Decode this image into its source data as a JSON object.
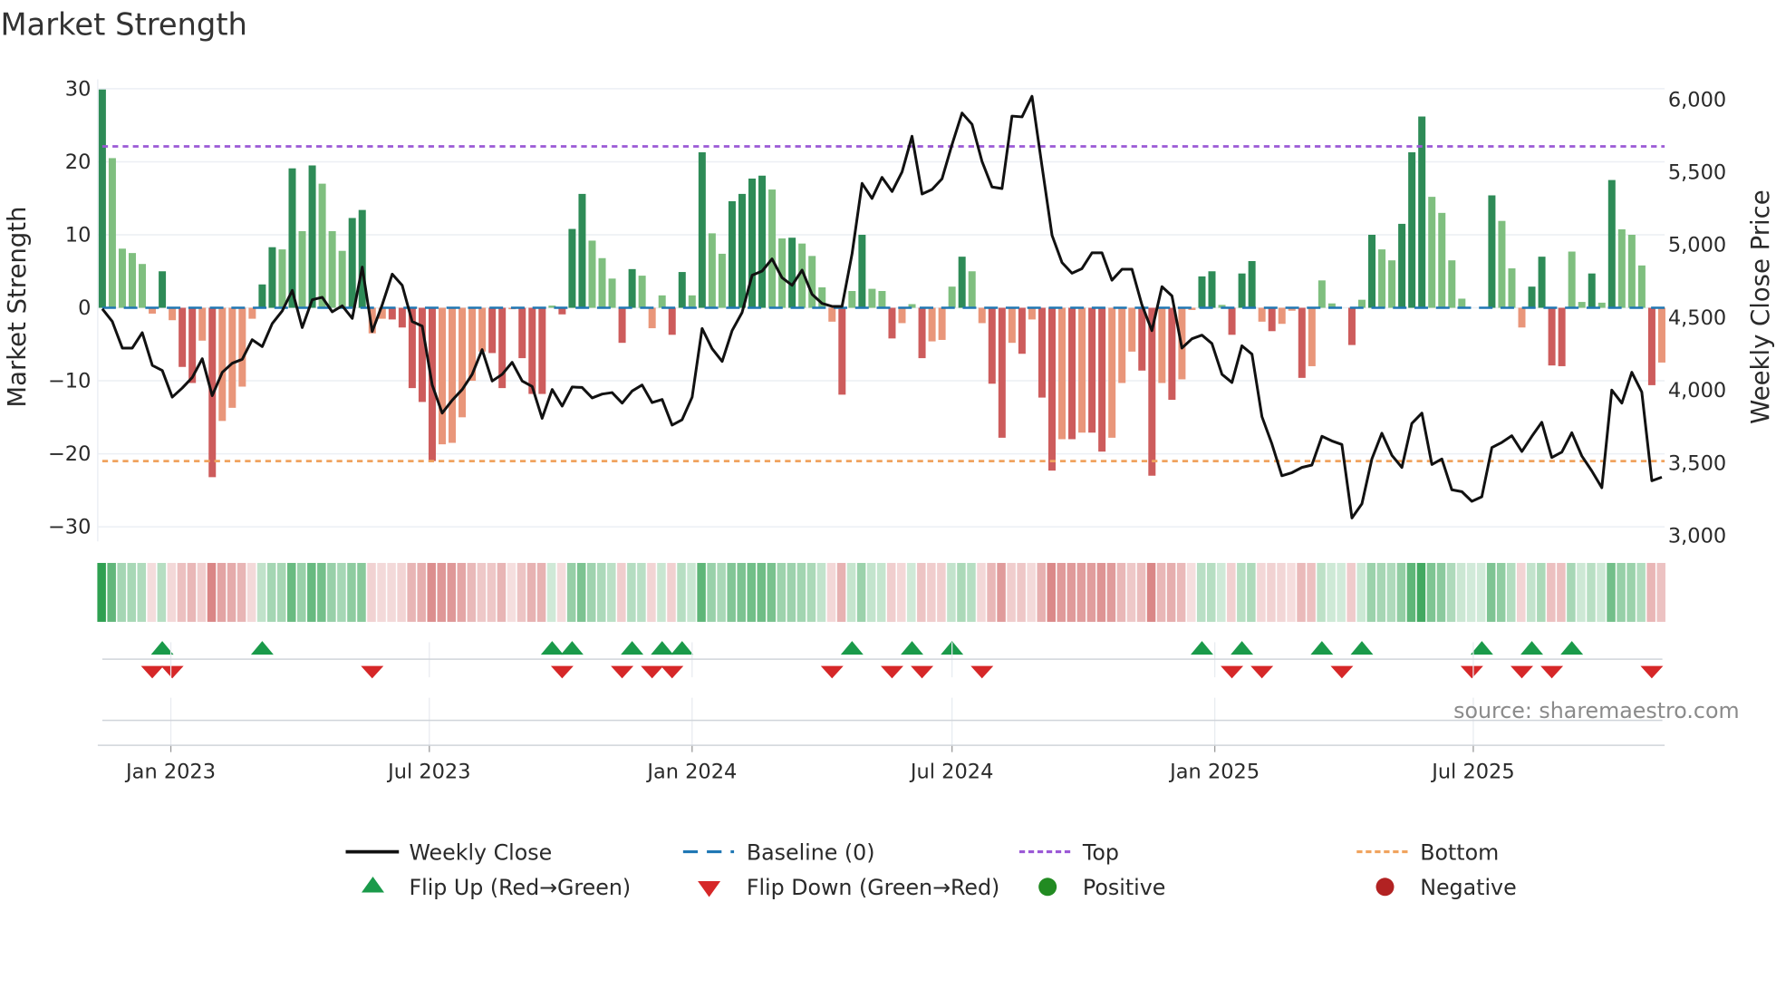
{
  "chart_data": {
    "type": "bar",
    "title": "Market Strength",
    "ylabel": "Market Strength",
    "y2label": "Weekly Close Price",
    "ylim": [
      -32,
      31.3
    ],
    "y2lim": [
      2953,
      6132
    ],
    "yticks": [
      30,
      20,
      10,
      0,
      -10,
      -20,
      -30
    ],
    "ytick_labels": [
      "30",
      "20",
      "10",
      "0",
      "−10",
      "−20",
      "−30"
    ],
    "y2ticks": [
      6000,
      5500,
      5000,
      4500,
      4000,
      3500,
      3000
    ],
    "y2tick_labels": [
      "6,000",
      "5,500",
      "5,000",
      "4,500",
      "4,000",
      "3,500",
      "3,000"
    ],
    "x_start": "2022-11-14",
    "x_step_days": 7,
    "xticks": [
      "2023-01-01",
      "2023-07-01",
      "2024-01-01",
      "2024-07-01",
      "2025-01-01",
      "2025-07-01"
    ],
    "xtick_labels": [
      "Jan 2023",
      "Jul 2023",
      "Jan 2024",
      "Jul 2024",
      "Jan 2025",
      "Jul 2025"
    ],
    "top": 22.1,
    "bottom": -21.0,
    "baseline": 0,
    "strength": [
      29.9,
      20.5,
      8.1,
      7.5,
      6,
      -0.8,
      5,
      -1.7,
      -8.1,
      -10.3,
      -4.5,
      -23.2,
      -15.5,
      -13.7,
      -10.8,
      -1.5,
      3.2,
      8.3,
      8,
      19.1,
      10.5,
      19.5,
      17,
      10.5,
      7.8,
      12.3,
      13.4,
      -3.5,
      -1.5,
      -1.6,
      -2.7,
      -11,
      -12.9,
      -21,
      -18.7,
      -18.5,
      -15,
      -10,
      -6,
      -6.2,
      -11,
      -0.2,
      -6.9,
      -11.8,
      -11.8,
      0.3,
      -0.9,
      10.8,
      15.6,
      9.2,
      6.8,
      4,
      -4.8,
      5.3,
      4.4,
      -2.8,
      1.7,
      -3.7,
      4.9,
      1.7,
      21.3,
      10.2,
      7.4,
      14.6,
      15.6,
      17.7,
      18.1,
      16.2,
      9.5,
      9.6,
      8.8,
      7.1,
      2.8,
      -1.9,
      -11.9,
      2.3,
      10,
      2.6,
      2.3,
      -4.2,
      -2.1,
      0.5,
      -6.9,
      -4.6,
      -4.4,
      2.9,
      7,
      5,
      -2.1,
      -10.4,
      -17.8,
      -4.8,
      -6.3,
      -1.6,
      -12.3,
      -22.3,
      -18,
      -18,
      -17.1,
      -17.1,
      -19.7,
      -17.8,
      -10.3,
      -6,
      -8.6,
      -23,
      -10.3,
      -12.6,
      -9.8,
      -0.3,
      4.3,
      5,
      0.4,
      -3.7,
      4.7,
      6.4,
      -1.9,
      -3.2,
      -2.2,
      -0.4,
      -9.6,
      -8,
      3.75,
      0.6,
      0,
      -5.1,
      1.1,
      10,
      8,
      6.5,
      11.5,
      21.3,
      26.2,
      15.2,
      13,
      6.5,
      1.25,
      0,
      0,
      15.4,
      11.9,
      5.4,
      -2.7,
      2.9,
      7,
      -7.9,
      -8,
      7.7,
      0.8,
      4.7,
      0.7,
      17.5,
      10.75,
      10,
      5.8,
      -10.6,
      -7.5
    ],
    "weekly_close": [
      4553,
      4466,
      4283,
      4283,
      4389,
      4164,
      4129,
      3946,
      4008,
      4081,
      4210,
      3956,
      4116,
      4179,
      4206,
      4341,
      4293,
      4451,
      4538,
      4680,
      4424,
      4615,
      4632,
      4532,
      4574,
      4487,
      4840,
      4397,
      4580,
      4792,
      4715,
      4466,
      4434,
      4029,
      3836,
      3925,
      3998,
      4102,
      4272,
      4056,
      4102,
      4185,
      4056,
      4019,
      3800,
      3998,
      3884,
      4015,
      4012,
      3940,
      3967,
      3977,
      3904,
      3988,
      4029,
      3908,
      3929,
      3753,
      3790,
      3946,
      4418,
      4279,
      4191,
      4403,
      4528,
      4784,
      4813,
      4896,
      4767,
      4715,
      4819,
      4653,
      4590,
      4570,
      4570,
      4934,
      5416,
      5312,
      5457,
      5360,
      5495,
      5740,
      5343,
      5374,
      5447,
      5682,
      5900,
      5823,
      5568,
      5391,
      5380,
      5879,
      5873,
      6015,
      5536,
      5058,
      4871,
      4798,
      4829,
      4938,
      4938,
      4750,
      4825,
      4825,
      4580,
      4403,
      4705,
      4642,
      4283,
      4347,
      4372,
      4314,
      4102,
      4046,
      4299,
      4241,
      3811,
      3624,
      3405,
      3426,
      3462,
      3478,
      3676,
      3644,
      3620,
      3114,
      3212,
      3520,
      3697,
      3545,
      3462,
      3765,
      3836,
      3482,
      3520,
      3308,
      3295,
      3229,
      3260,
      3599,
      3634,
      3680,
      3572,
      3676,
      3773,
      3530,
      3568,
      3701,
      3541,
      3437,
      3322,
      3994,
      3904,
      4116,
      3981,
      3370,
      3395
    ],
    "flip_up_index": [
      6,
      16,
      45,
      47,
      53,
      56,
      58,
      75,
      81,
      85,
      110,
      114,
      122,
      126,
      138,
      143,
      147
    ],
    "flip_down_index": [
      5,
      7,
      27,
      46,
      52,
      55,
      57,
      73,
      79,
      82,
      88,
      113,
      116,
      124,
      137,
      142,
      145,
      155
    ],
    "legend": {
      "placement": "bottom",
      "items": [
        {
          "label": "Weekly Close",
          "kind": "line"
        },
        {
          "label": "Baseline (0)",
          "kind": "dash"
        },
        {
          "label": "Top",
          "kind": "dot-top"
        },
        {
          "label": "Bottom",
          "kind": "dot-bottom"
        },
        {
          "label": "Flip Up (Red→Green)",
          "kind": "tri-up"
        },
        {
          "label": "Flip Down (Green→Red)",
          "kind": "tri-down"
        },
        {
          "label": "Positive",
          "kind": "circle-pos"
        },
        {
          "label": "Negative",
          "kind": "circle-neg"
        }
      ]
    },
    "source_note": "source: sharemaestro.com",
    "colors": {
      "pos_strong": "#2e8b57",
      "pos_weak": "#7fbf7f",
      "neg_strong": "#cd5c5c",
      "neg_weak": "#e9967a",
      "price": "#111111",
      "baseline": "#1f77b4",
      "top": "#9b59d6",
      "bottom": "#f0a35e",
      "flip_up": "#1a9a4a",
      "flip_down": "#d62728",
      "positive": "#228b22",
      "negative": "#b22222"
    }
  }
}
